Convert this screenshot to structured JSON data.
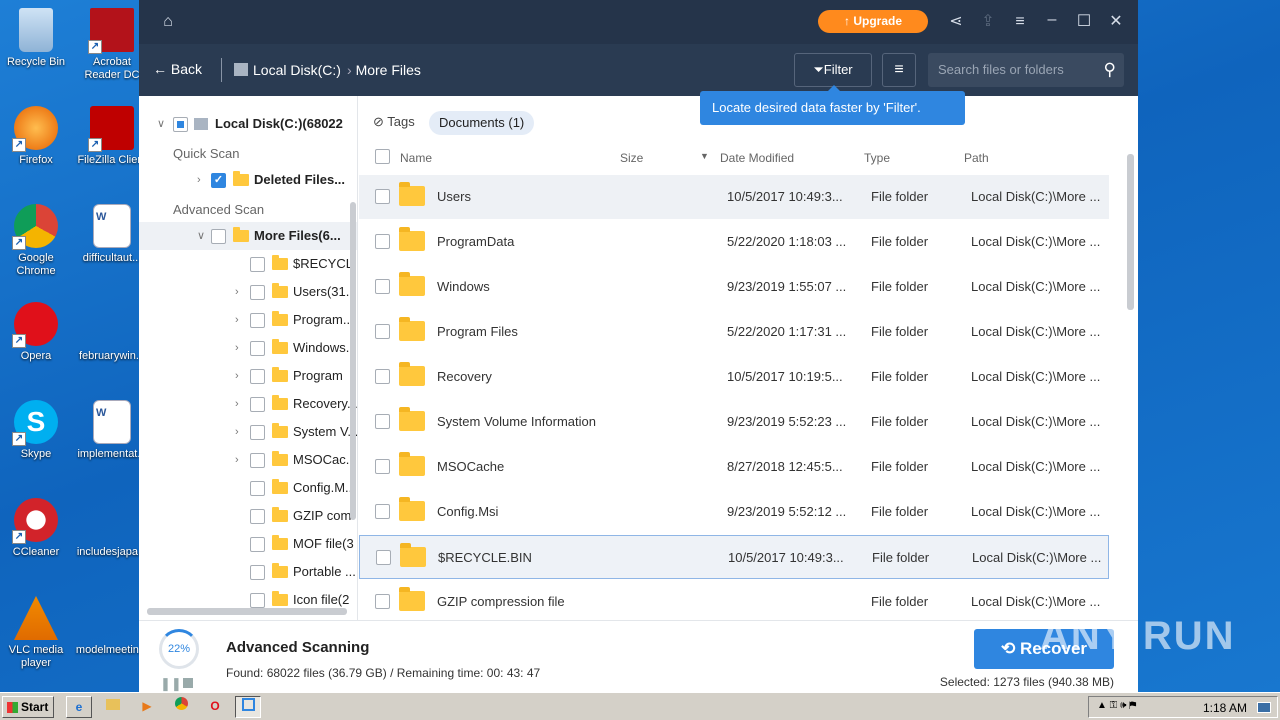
{
  "desktop": {
    "icons": [
      {
        "label": "Recycle Bin",
        "icon": "recycle-bin-icon"
      },
      {
        "label": "Acrobat Reader DC",
        "icon": "acrobat-icon"
      },
      {
        "label": "Firefox",
        "icon": "firefox-icon"
      },
      {
        "label": "FileZilla Client",
        "icon": "filezilla-icon"
      },
      {
        "label": "Google Chrome",
        "icon": "chrome-icon"
      },
      {
        "label": "difficultaut...",
        "icon": "word-doc-icon"
      },
      {
        "label": "Opera",
        "icon": "opera-icon"
      },
      {
        "label": "februarywin...",
        "icon": "blank-doc-icon"
      },
      {
        "label": "Skype",
        "icon": "skype-icon"
      },
      {
        "label": "implementat...",
        "icon": "word-doc-icon"
      },
      {
        "label": "CCleaner",
        "icon": "ccleaner-icon"
      },
      {
        "label": "includesjapa...",
        "icon": "blank-doc-icon"
      },
      {
        "label": "VLC media player",
        "icon": "vlc-icon"
      },
      {
        "label": "modelmeetin...",
        "icon": "blank-doc-icon"
      }
    ]
  },
  "app": {
    "upgrade_label": "Upgrade",
    "nav": {
      "back_label": "Back",
      "crumbs": [
        "Local Disk(C:)",
        "More Files"
      ],
      "filter_label": "Filter",
      "search_placeholder": "Search files or folders"
    },
    "tooltip": "Locate desired data faster by 'Filter'.",
    "tree": {
      "root": "Local Disk(C:)(68022",
      "quick_scan": "Quick Scan",
      "deleted_files": "Deleted Files...",
      "advanced_scan": "Advanced Scan",
      "more_files": "More Files(6...",
      "children": [
        {
          "label": "$RECYCL...",
          "expandable": false
        },
        {
          "label": "Users(31...",
          "expandable": true
        },
        {
          "label": "Program...",
          "expandable": true
        },
        {
          "label": "Windows...",
          "expandable": true
        },
        {
          "label": "Program",
          "expandable": true
        },
        {
          "label": "Recovery...",
          "expandable": true
        },
        {
          "label": "System V...",
          "expandable": true
        },
        {
          "label": "MSOCac...",
          "expandable": true
        },
        {
          "label": "Config.M...",
          "expandable": false
        },
        {
          "label": "GZIP com",
          "expandable": false
        },
        {
          "label": "MOF file(3",
          "expandable": false
        },
        {
          "label": "Portable ...",
          "expandable": false
        },
        {
          "label": "Icon file(2",
          "expandable": false
        }
      ]
    },
    "list": {
      "tags_label": "Tags",
      "doc_chip": "Documents (1)",
      "columns": {
        "name": "Name",
        "size": "Size",
        "date": "Date Modified",
        "type": "Type",
        "path": "Path"
      },
      "rows": [
        {
          "name": "Users",
          "date": "10/5/2017 10:49:3...",
          "type": "File folder",
          "path": "Local Disk(C:)\\More ..."
        },
        {
          "name": "ProgramData",
          "date": "5/22/2020 1:18:03 ...",
          "type": "File folder",
          "path": "Local Disk(C:)\\More ..."
        },
        {
          "name": "Windows",
          "date": "9/23/2019 1:55:07 ...",
          "type": "File folder",
          "path": "Local Disk(C:)\\More ..."
        },
        {
          "name": "Program Files",
          "date": "5/22/2020 1:17:31 ...",
          "type": "File folder",
          "path": "Local Disk(C:)\\More ..."
        },
        {
          "name": "Recovery",
          "date": "10/5/2017 10:19:5...",
          "type": "File folder",
          "path": "Local Disk(C:)\\More ..."
        },
        {
          "name": "System Volume Information",
          "date": "9/23/2019 5:52:23 ...",
          "type": "File folder",
          "path": "Local Disk(C:)\\More ..."
        },
        {
          "name": "MSOCache",
          "date": "8/27/2018 12:45:5...",
          "type": "File folder",
          "path": "Local Disk(C:)\\More ..."
        },
        {
          "name": "Config.Msi",
          "date": "9/23/2019 5:52:12 ...",
          "type": "File folder",
          "path": "Local Disk(C:)\\More ..."
        },
        {
          "name": "$RECYCLE.BIN",
          "date": "10/5/2017 10:49:3...",
          "type": "File folder",
          "path": "Local Disk(C:)\\More ..."
        },
        {
          "name": "GZIP compression file",
          "date": "",
          "type": "File folder",
          "path": "Local Disk(C:)\\More ..."
        }
      ]
    },
    "footer": {
      "progress": "22%",
      "scan_title": "Advanced Scanning",
      "found": "Found: 68022 files (36.79 GB) / Remaining time: 00: 43: 47",
      "recover_label": "Recover",
      "selected": "Selected: 1273 files (940.38 MB)"
    }
  },
  "watermark": "ANY RUN",
  "taskbar": {
    "start_label": "Start",
    "clock": "1:18 AM"
  }
}
